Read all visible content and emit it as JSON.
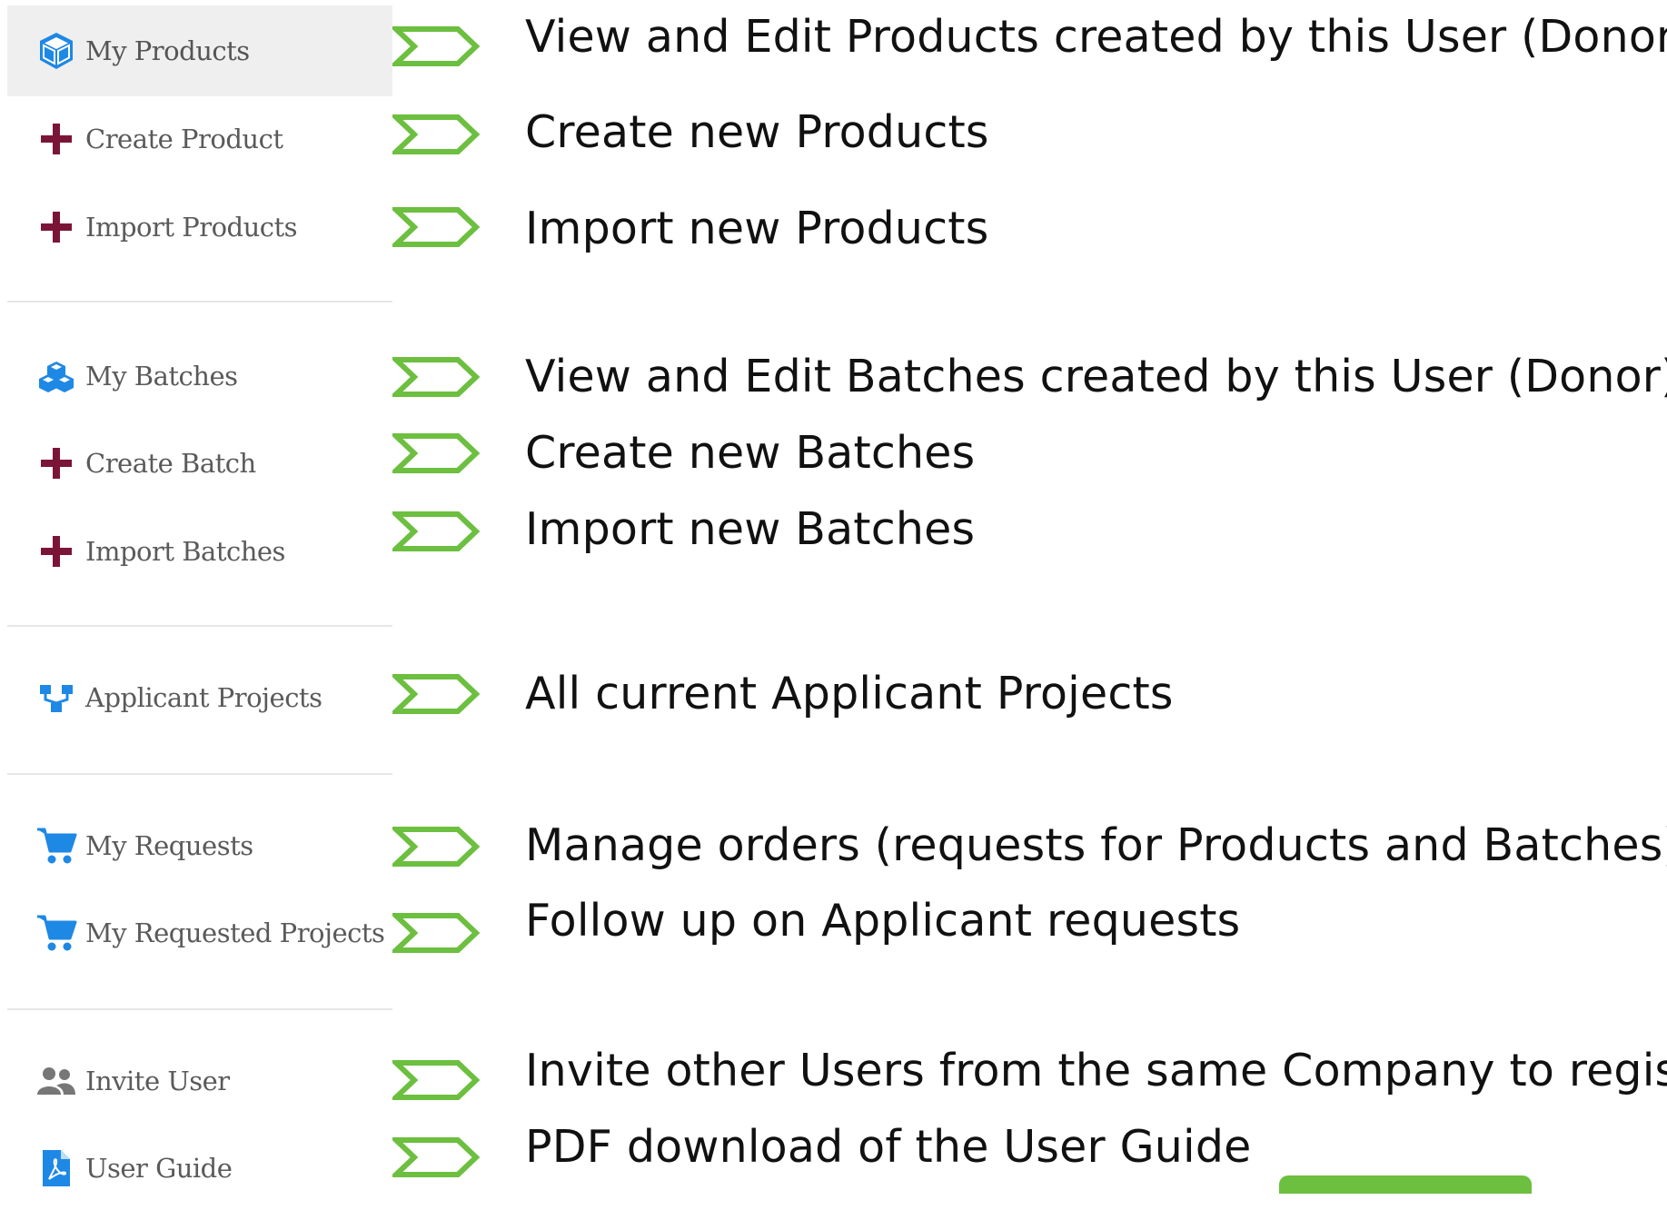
{
  "colors": {
    "active_bg": "#efefef",
    "label": "#5a5a5a",
    "blue_icon": "#1e88e5",
    "plus_icon": "#7b1538",
    "gray_icon": "#777777",
    "arrow_stroke": "#6cbf3f",
    "description": "#111111"
  },
  "sidebar": {
    "items": [
      {
        "label": "My Products",
        "icon": "cube-icon",
        "active": true
      },
      {
        "label": "Create Product",
        "icon": "plus-icon"
      },
      {
        "label": "Import Products",
        "icon": "plus-icon"
      },
      {
        "label": "My Batches",
        "icon": "cubes-icon"
      },
      {
        "label": "Create Batch",
        "icon": "plus-icon"
      },
      {
        "label": "Import Batches",
        "icon": "plus-icon"
      },
      {
        "label": "Applicant Projects",
        "icon": "sitemap-icon"
      },
      {
        "label": "My Requests",
        "icon": "cart-icon"
      },
      {
        "label": "My Requested Projects",
        "icon": "cart-icon"
      },
      {
        "label": "Invite User",
        "icon": "users-icon"
      },
      {
        "label": "User Guide",
        "icon": "pdf-icon"
      }
    ]
  },
  "descriptions": [
    "View and Edit Products created by this User (Donor)",
    "Create new Products",
    "Import new Products",
    "View and Edit Batches created by this User (Donor)",
    "Create new Batches",
    "Import new Batches",
    "All current Applicant Projects",
    "Manage orders (requests for Products and Batches)",
    "Follow up on Applicant requests",
    "Invite other Users from the same Company to register",
    "PDF download of the User Guide"
  ]
}
